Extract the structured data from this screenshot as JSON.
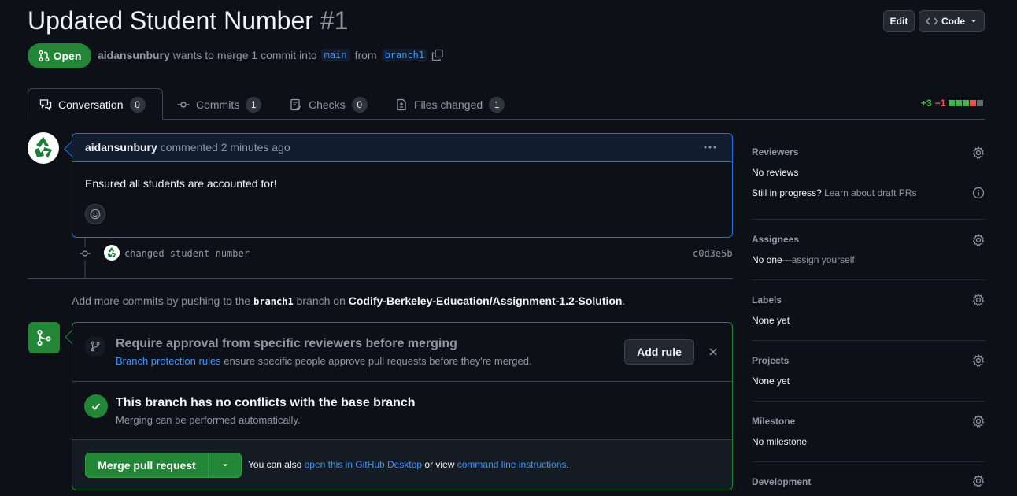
{
  "header": {
    "title": "Updated Student Number",
    "number": "#1",
    "edit_label": "Edit",
    "code_label": "Code"
  },
  "status": {
    "state": "Open",
    "author": "aidansunbury",
    "merge_text": "wants to merge 1 commit into",
    "base_branch": "main",
    "from_text": "from",
    "head_branch": "branch1"
  },
  "tabs": [
    {
      "label": "Conversation",
      "count": "0"
    },
    {
      "label": "Commits",
      "count": "1"
    },
    {
      "label": "Checks",
      "count": "0"
    },
    {
      "label": "Files changed",
      "count": "1"
    }
  ],
  "diffstat": {
    "additions": "+3",
    "deletions": "−1"
  },
  "comment": {
    "author": "aidansunbury",
    "meta": "commented 2 minutes ago",
    "body": "Ensured all students are accounted for!"
  },
  "commit": {
    "message": "changed student number",
    "sha": "c0d3e5b"
  },
  "push_note": {
    "prefix": "Add more commits by pushing to the",
    "branch": "branch1",
    "middle": "branch on",
    "repo": "Codify-Berkeley-Education/Assignment-1.2-Solution",
    "suffix": "."
  },
  "merge_box": {
    "protect_title": "Require approval from specific reviewers before merging",
    "protect_link": "Branch protection rules",
    "protect_text": "ensure specific people approve pull requests before they're merged.",
    "add_rule_label": "Add rule",
    "conflict_title": "This branch has no conflicts with the base branch",
    "conflict_sub": "Merging can be performed automatically.",
    "merge_label": "Merge pull request",
    "also_text": "You can also",
    "desktop_link": "open this in GitHub Desktop",
    "or_view": "or view",
    "cli_link": "command line instructions",
    "period": "."
  },
  "sidebar": {
    "reviewers": {
      "title": "Reviewers",
      "value": "No reviews",
      "draft_q": "Still in progress?",
      "draft_link": "Learn about draft PRs"
    },
    "assignees": {
      "title": "Assignees",
      "value": "No one—",
      "assign_link": "assign yourself"
    },
    "labels": {
      "title": "Labels",
      "value": "None yet"
    },
    "projects": {
      "title": "Projects",
      "value": "None yet"
    },
    "milestone": {
      "title": "Milestone",
      "value": "No milestone"
    },
    "development": {
      "title": "Development"
    }
  },
  "colors": {
    "green": "#238636",
    "bg": "#0d1117",
    "accent": "#4493f8"
  }
}
